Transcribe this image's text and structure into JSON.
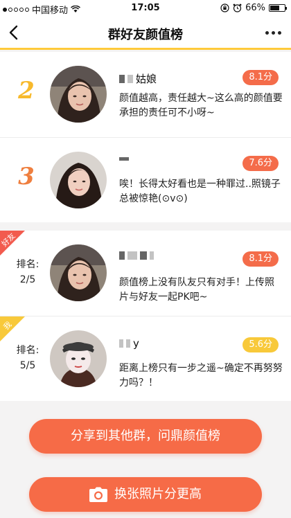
{
  "status_bar": {
    "carrier": "中国移动",
    "time": "17:05",
    "battery": "66%",
    "battery_level": 0.66
  },
  "nav": {
    "title": "群好友颜值榜",
    "back_icon": "chevron-left-icon",
    "more_icon": "more-dots-icon"
  },
  "ranking": [
    {
      "rank": "2",
      "name_visible": "姑娘",
      "score": "8.1分",
      "comment": "颜值越高，责任越大~这么高的颜值要承担的责任可不小呀~"
    },
    {
      "rank": "3",
      "name_visible": "",
      "score": "7.6分",
      "comment": "唉！长得太好看也是一种罪过..照镜子总被惊艳(⊙v⊙)"
    }
  ],
  "friends": [
    {
      "tag": "好友",
      "rank_label": "排名:",
      "rank_value": "2/5",
      "name_visible": "",
      "score": "8.1分",
      "comment": "颜值榜上没有队友只有对手！上传照片与好友一起PK吧~"
    },
    {
      "tag": "我",
      "rank_label": "排名:",
      "rank_value": "5/5",
      "name_visible": "y",
      "score": "5.6分",
      "comment": "距离上榜只有一步之遥~确定不再努努力吗？！"
    }
  ],
  "buttons": {
    "share": "分享到其他群，问鼎颜值榜",
    "photo": "换张照片分更高",
    "photo_icon": "camera-icon"
  },
  "colors": {
    "accent": "#f66b47",
    "gold": "#f7b92c",
    "yellow_badge": "#f8c93a",
    "divider": "#ffca3a"
  }
}
